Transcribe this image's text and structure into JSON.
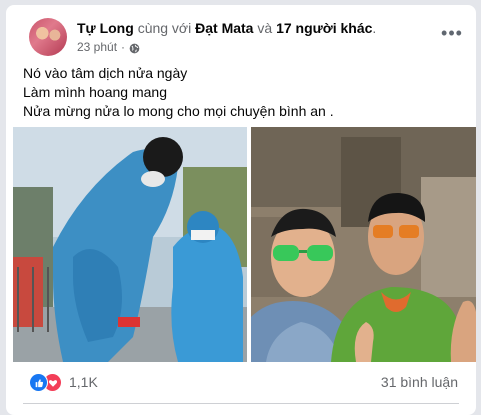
{
  "post": {
    "author": "Tự Long",
    "with_text": "cùng với",
    "tagged": "Đạt Mata",
    "and_text": "và",
    "others": "17 người khác",
    "period": ".",
    "time": "23 phút",
    "dot": "·",
    "more": "•••",
    "lines": [
      "Nó vào tâm dịch nửa ngày",
      "Làm mình hoang mang",
      "Nửa mừng nửa lo mong cho mọi chuyện bình an ."
    ]
  },
  "photos": [
    {
      "name": "photo-left"
    },
    {
      "name": "photo-right"
    }
  ],
  "engagement": {
    "reaction_count": "1,1K",
    "comments": "31 bình luận"
  },
  "colors": {
    "like": "#1877f2",
    "love": "#f33e58",
    "muted_text": "#65676b"
  },
  "icons": {
    "privacy": "globe-icon",
    "menu": "more-options-icon",
    "like": "like-icon",
    "love": "love-icon"
  }
}
